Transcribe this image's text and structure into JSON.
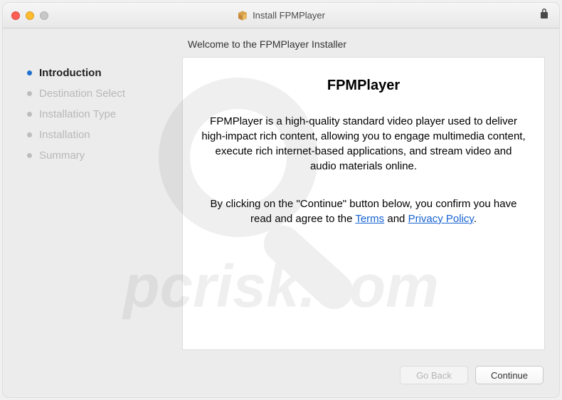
{
  "window": {
    "title": "Install FPMPlayer"
  },
  "welcome": "Welcome to the FPMPlayer Installer",
  "sidebar": {
    "steps": [
      {
        "label": "Introduction",
        "active": true
      },
      {
        "label": "Destination Select",
        "active": false
      },
      {
        "label": "Installation Type",
        "active": false
      },
      {
        "label": "Installation",
        "active": false
      },
      {
        "label": "Summary",
        "active": false
      }
    ]
  },
  "content": {
    "title": "FPMPlayer",
    "description": "FPMPlayer is a high-quality standard video player used to deliver high-impact rich content, allowing you to engage multimedia content, execute rich internet-based applications, and stream video and audio materials online.",
    "agree_pre": "By clicking on the \"Continue\" button below, you confirm you have read and agree to the ",
    "terms_label": "Terms",
    "agree_mid": " and ",
    "privacy_label": "Privacy Policy",
    "agree_post": "."
  },
  "footer": {
    "go_back": "Go Back",
    "continue": "Continue"
  },
  "watermark": {
    "text": "pcrisk.com"
  }
}
